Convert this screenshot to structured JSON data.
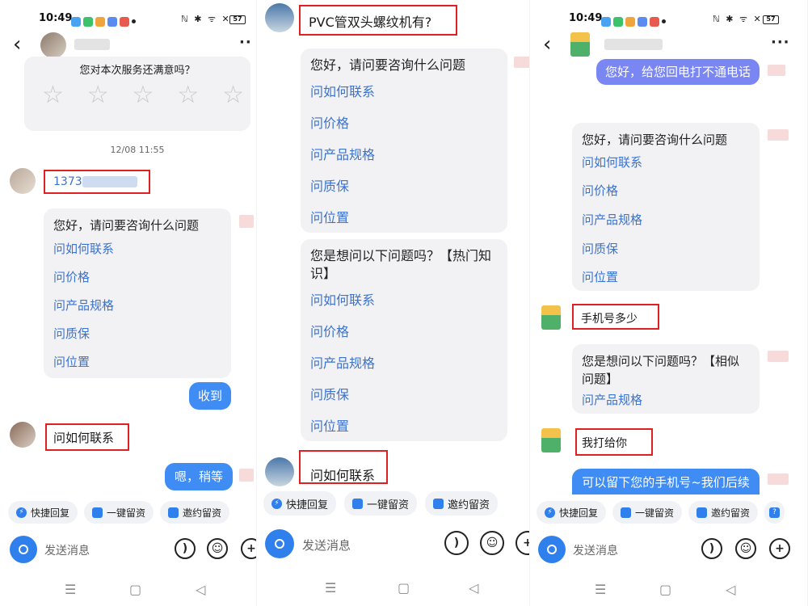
{
  "p1": {
    "status_time": "10:49",
    "battery": "57",
    "satisfaction_question": "您对本次服务还满意吗？",
    "timestamp": "12/08 11:55",
    "phone_partial": "1373",
    "card": {
      "question": "您好，请问要咨询什么问题",
      "options": [
        "问如何联系",
        "问价格",
        "问产品规格",
        "问质保",
        "问位置"
      ]
    },
    "received_reply": "收到",
    "user_msg": "问如何联系",
    "wait_reply": "嗯，稍等"
  },
  "p2": {
    "top_msg": "PVC管双头螺纹机有?",
    "card1": {
      "question": "您好，请问要咨询什么问题",
      "options": [
        "问如何联系",
        "问价格",
        "问产品规格",
        "问质保",
        "问位置"
      ]
    },
    "card2": {
      "question": "您是想问以下问题吗？【热门知识】",
      "options": [
        "问如何联系",
        "问价格",
        "问产品规格",
        "问质保",
        "问位置"
      ]
    },
    "user_msg": "问如何联系"
  },
  "p3": {
    "status_time": "10:49",
    "battery": "57",
    "callback_msg": "您好，给您回电打不通电话",
    "card1": {
      "question": "您好，请问要咨询什么问题",
      "options": [
        "问如何联系",
        "问价格",
        "问产品规格",
        "问质保",
        "问位置"
      ]
    },
    "user_msg1": "手机号多少",
    "card2": {
      "question": "您是想问以下问题吗？【相似问题】",
      "options": [
        "问产品规格"
      ]
    },
    "user_msg2": "我打给你",
    "leave_phone_msg": "可以留下您的手机号~我们后续"
  },
  "quick_actions": {
    "quick_reply": "快捷回复",
    "one_click_leave": "一键留资",
    "invite_leave": "邀约留资"
  },
  "input": {
    "placeholder": "发送消息"
  },
  "nav": {
    "menu": "☰",
    "home": "▢",
    "back": "◁"
  },
  "colors": {
    "accent": "#3f8cf5",
    "link": "#3a73d0",
    "highlight": "#e02020",
    "bubble_alt": "#7a86f2"
  }
}
